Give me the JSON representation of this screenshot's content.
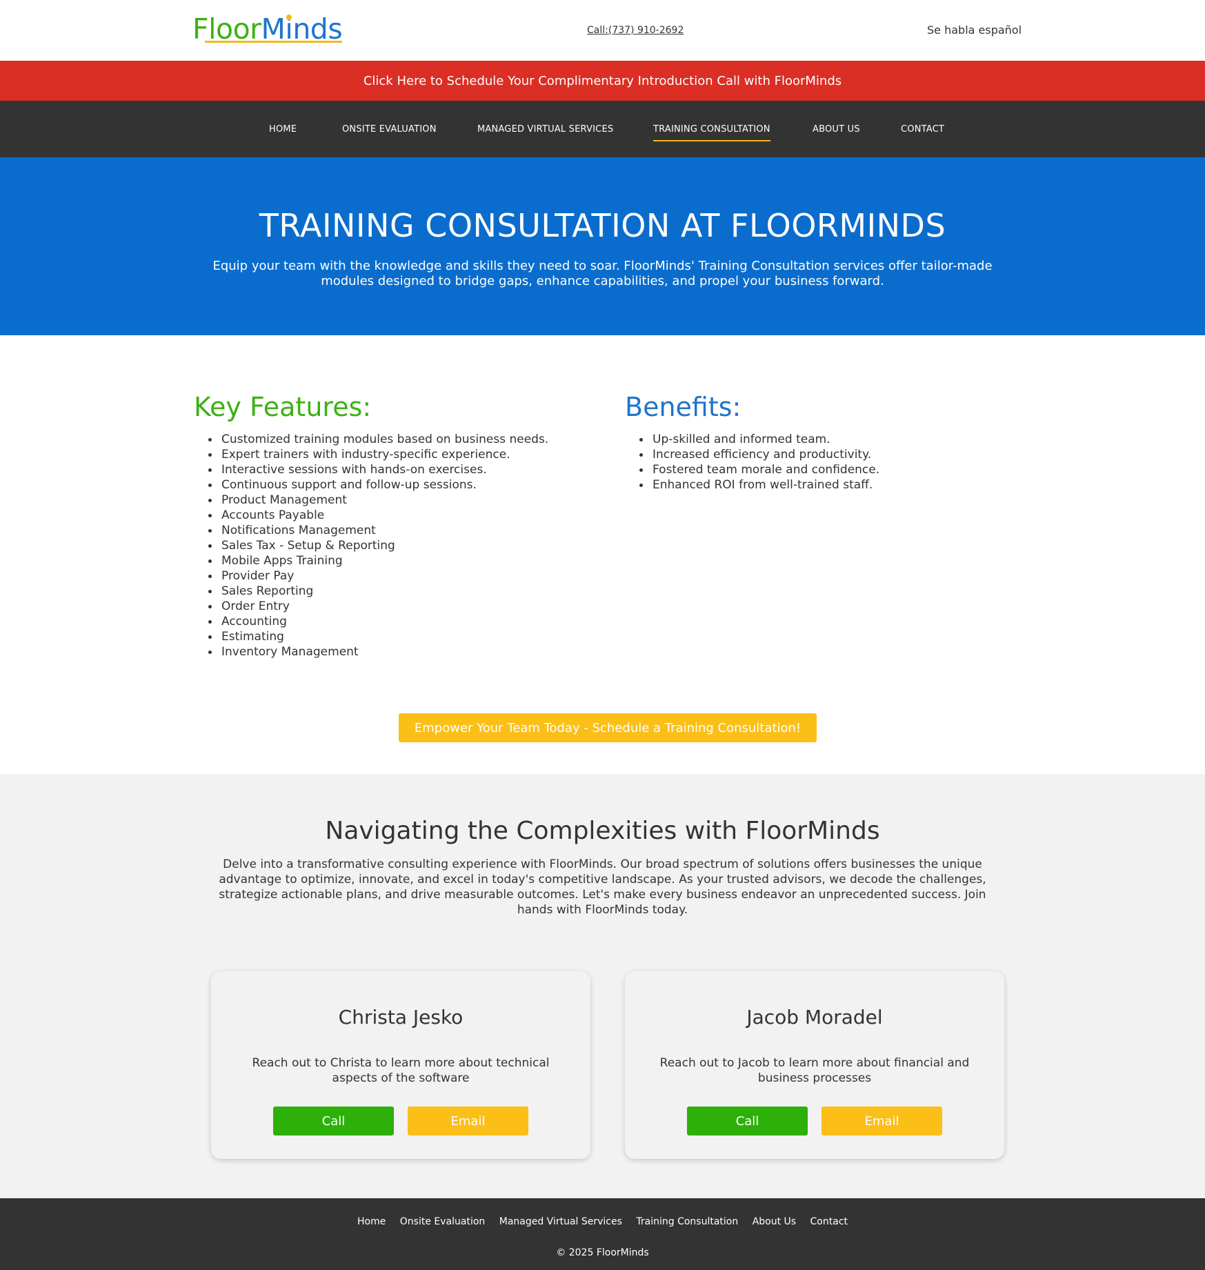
{
  "header": {
    "logo_parts": [
      "F",
      "l",
      "oor",
      "M",
      "i",
      "nds"
    ],
    "phone": "Call:(737) 910-2692",
    "spanish": "Se habla español"
  },
  "banner": {
    "text": "Click Here to Schedule Your Complimentary Introduction Call with FloorMinds"
  },
  "nav": {
    "items": [
      "HOME",
      "ONSITE EVALUATION",
      "MANAGED VIRTUAL SERVICES",
      "TRAINING CONSULTATION",
      "ABOUT US",
      "CONTACT"
    ],
    "active": "TRAINING CONSULTATION"
  },
  "hero": {
    "title": "TRAINING CONSULTATION AT FLOORMINDS",
    "subtitle": "Equip your team with the knowledge and skills they need to soar. FloorMinds' Training Consultation services offer tailor-made modules designed to bridge gaps, enhance capabilities, and propel your business forward."
  },
  "features": {
    "title": "Key Features:",
    "items": [
      "Customized training modules based on business needs.",
      "Expert trainers with industry-specific experience.",
      "Interactive sessions with hands-on exercises.",
      "Continuous support and follow-up sessions.",
      "Product Management",
      "Accounts Payable",
      "Notifications Management",
      "Sales Tax - Setup & Reporting",
      "Mobile Apps Training",
      "Provider Pay",
      "Sales Reporting",
      "Order Entry",
      "Accounting",
      "Estimating",
      "Inventory Management"
    ]
  },
  "benefits": {
    "title": "Benefits:",
    "items": [
      "Up-skilled and informed team.",
      "Increased efficiency and productivity.",
      "Fostered team morale and confidence.",
      "Enhanced ROI from well-trained staff."
    ]
  },
  "cta": {
    "label": "Empower Your Team Today - Schedule a Training Consultation!"
  },
  "complexities": {
    "title": "Navigating the Complexities with FloorMinds",
    "body": "Delve into a transformative consulting experience with FloorMinds. Our broad spectrum of solutions offers businesses the unique advantage to optimize, innovate, and excel in today's competitive landscape. As your trusted advisors, we decode the challenges, strategize actionable plans, and drive measurable outcomes. Let's make every business endeavor an unprecedented success. Join hands with FloorMinds today."
  },
  "contacts": [
    {
      "name": "Christa Jesko",
      "description": "Reach out to Christa to learn more about technical aspects of the software",
      "call_label": "Call",
      "email_label": "Email"
    },
    {
      "name": "Jacob Moradel",
      "description": "Reach out to Jacob to learn more about financial and business processes",
      "call_label": "Call",
      "email_label": "Email"
    }
  ],
  "footer": {
    "links": [
      "Home",
      "Onsite Evaluation",
      "Managed Virtual Services",
      "Training Consultation",
      "About Us",
      "Contact"
    ],
    "copyright": "© 2025 FloorMinds"
  },
  "colors": {
    "brand_green": "#3cb112",
    "brand_blue": "#1f74cf",
    "accent_yellow": "#fbbf18",
    "banner_red": "#db2e24",
    "nav_dark": "#333333",
    "hero_blue": "#0a6dce"
  }
}
